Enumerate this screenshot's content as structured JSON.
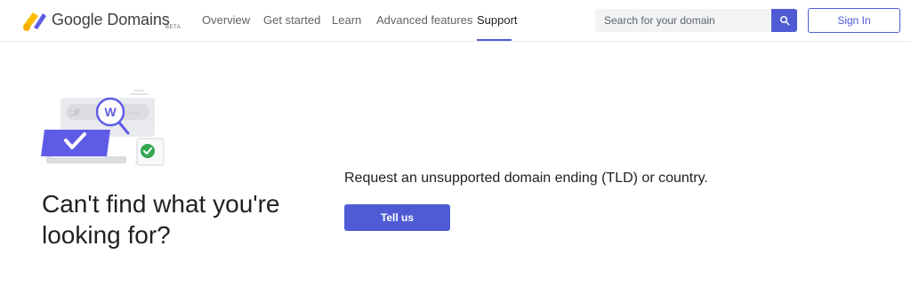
{
  "header": {
    "brand": "Google Domains",
    "beta": "BETA",
    "nav": [
      {
        "label": "Overview"
      },
      {
        "label": "Get started"
      },
      {
        "label": "Learn"
      },
      {
        "label": "Advanced features"
      },
      {
        "label": "Support",
        "active": true
      }
    ],
    "search": {
      "placeholder": "Search for your domain",
      "value": "",
      "icon": "search-icon"
    },
    "signin_label": "Sign In"
  },
  "main": {
    "illustration": {
      "letter": "W",
      "icons": [
        "magnifier-icon",
        "checkmark-icon",
        "check-badge-icon"
      ]
    },
    "headline": "Can't find what you're looking for?",
    "request_text": "Request an unsupported domain ending (TLD) or country.",
    "cta_label": "Tell us"
  },
  "colors": {
    "accent": "#4f5bd5",
    "green": "#34a853",
    "logo_yellow": "#fbbc04",
    "logo_purple": "#5e5ce6"
  }
}
